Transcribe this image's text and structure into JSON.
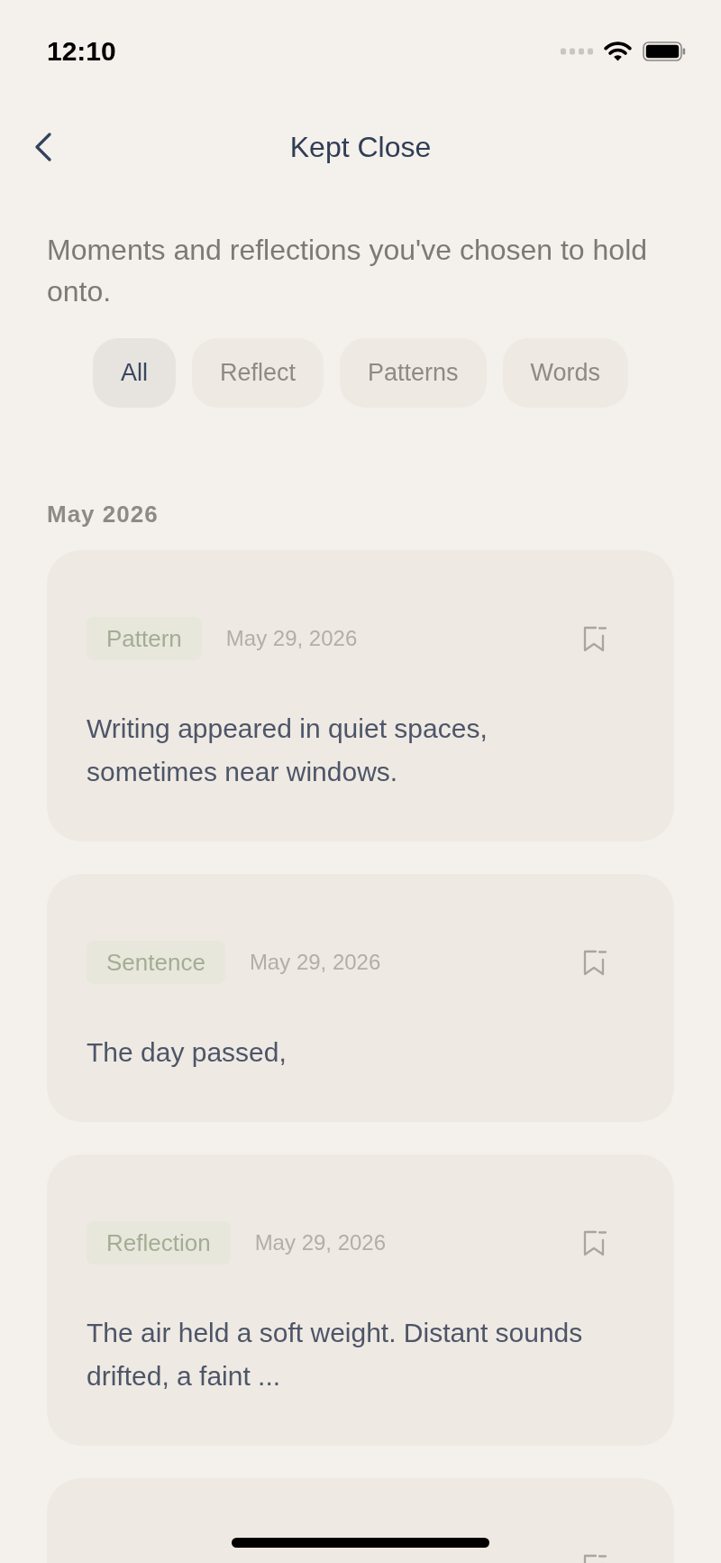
{
  "status_bar": {
    "time": "12:10"
  },
  "header": {
    "title": "Kept Close"
  },
  "subtitle": "Moments and reflections you've chosen to hold onto.",
  "filters": [
    {
      "label": "All",
      "selected": true
    },
    {
      "label": "Reflect",
      "selected": false
    },
    {
      "label": "Patterns",
      "selected": false
    },
    {
      "label": "Words",
      "selected": false
    }
  ],
  "sections": [
    {
      "title": "May 2026",
      "entries": [
        {
          "kind": "full",
          "tag": "Pattern",
          "date": "May 29, 2026",
          "text": "Writing appeared in quiet spaces, sometimes near windows."
        },
        {
          "kind": "full",
          "tag": "Sentence",
          "date": "May 29, 2026",
          "text": "The day passed,"
        },
        {
          "kind": "full",
          "tag": "Reflection",
          "date": "May 29, 2026",
          "text": "The air held a soft weight. Distant sounds drifted, a faint ..."
        },
        {
          "kind": "clipped"
        }
      ]
    }
  ]
}
